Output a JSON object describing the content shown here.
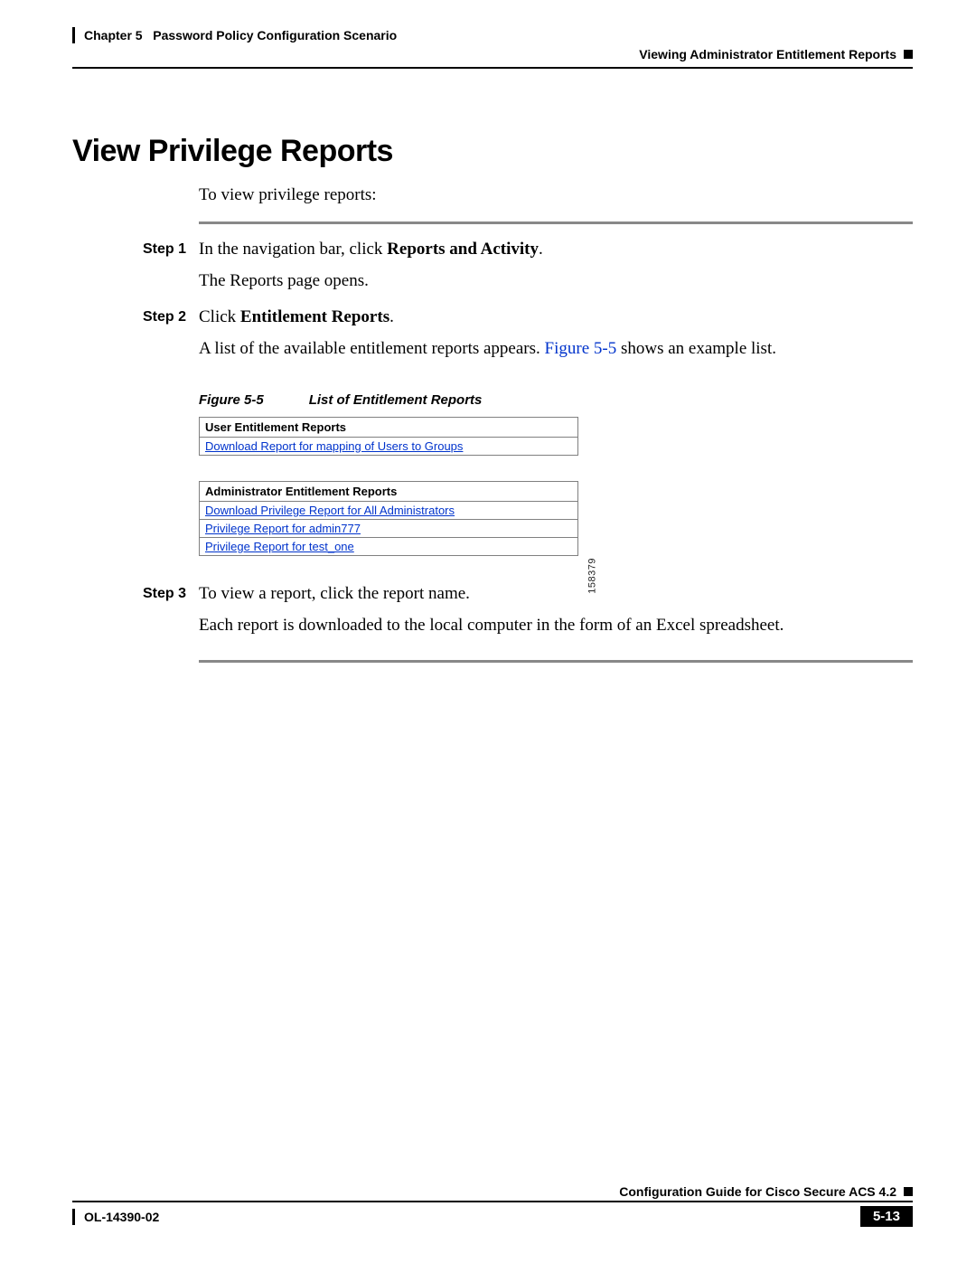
{
  "header": {
    "chapter_label": "Chapter 5",
    "chapter_title": "Password Policy Configuration Scenario",
    "section_right": "Viewing Administrator Entitlement Reports"
  },
  "title": "View Privilege Reports",
  "intro": "To view privilege reports:",
  "steps": [
    {
      "label": "Step 1",
      "line1_pre": "In the navigation bar, click ",
      "line1_bold": "Reports and Activity",
      "line1_post": ".",
      "line2": "The Reports page opens."
    },
    {
      "label": "Step 2",
      "line1_pre": "Click ",
      "line1_bold": "Entitlement Reports",
      "line1_post": ".",
      "line2_pre": "A list of the available entitlement reports appears. ",
      "line2_link": "Figure 5-5",
      "line2_post": " shows an example list."
    },
    {
      "label": "Step 3",
      "line1": "To view a report, click the report name.",
      "line2": "Each report is downloaded to the local computer in the form of an Excel spreadsheet."
    }
  ],
  "figure": {
    "num": "Figure 5-5",
    "title": "List of Entitlement Reports",
    "image_id": "158379",
    "table1": {
      "header": "User Entitlement Reports",
      "rows": [
        "Download Report for mapping of Users to Groups"
      ]
    },
    "table2": {
      "header": "Administrator Entitlement Reports",
      "rows": [
        "Download Privilege Report for All Administrators",
        "Privilege Report for admin777",
        "Privilege Report for test_one"
      ]
    }
  },
  "footer": {
    "guide": "Configuration Guide for Cisco Secure ACS 4.2",
    "doc_id": "OL-14390-02",
    "page": "5-13"
  }
}
